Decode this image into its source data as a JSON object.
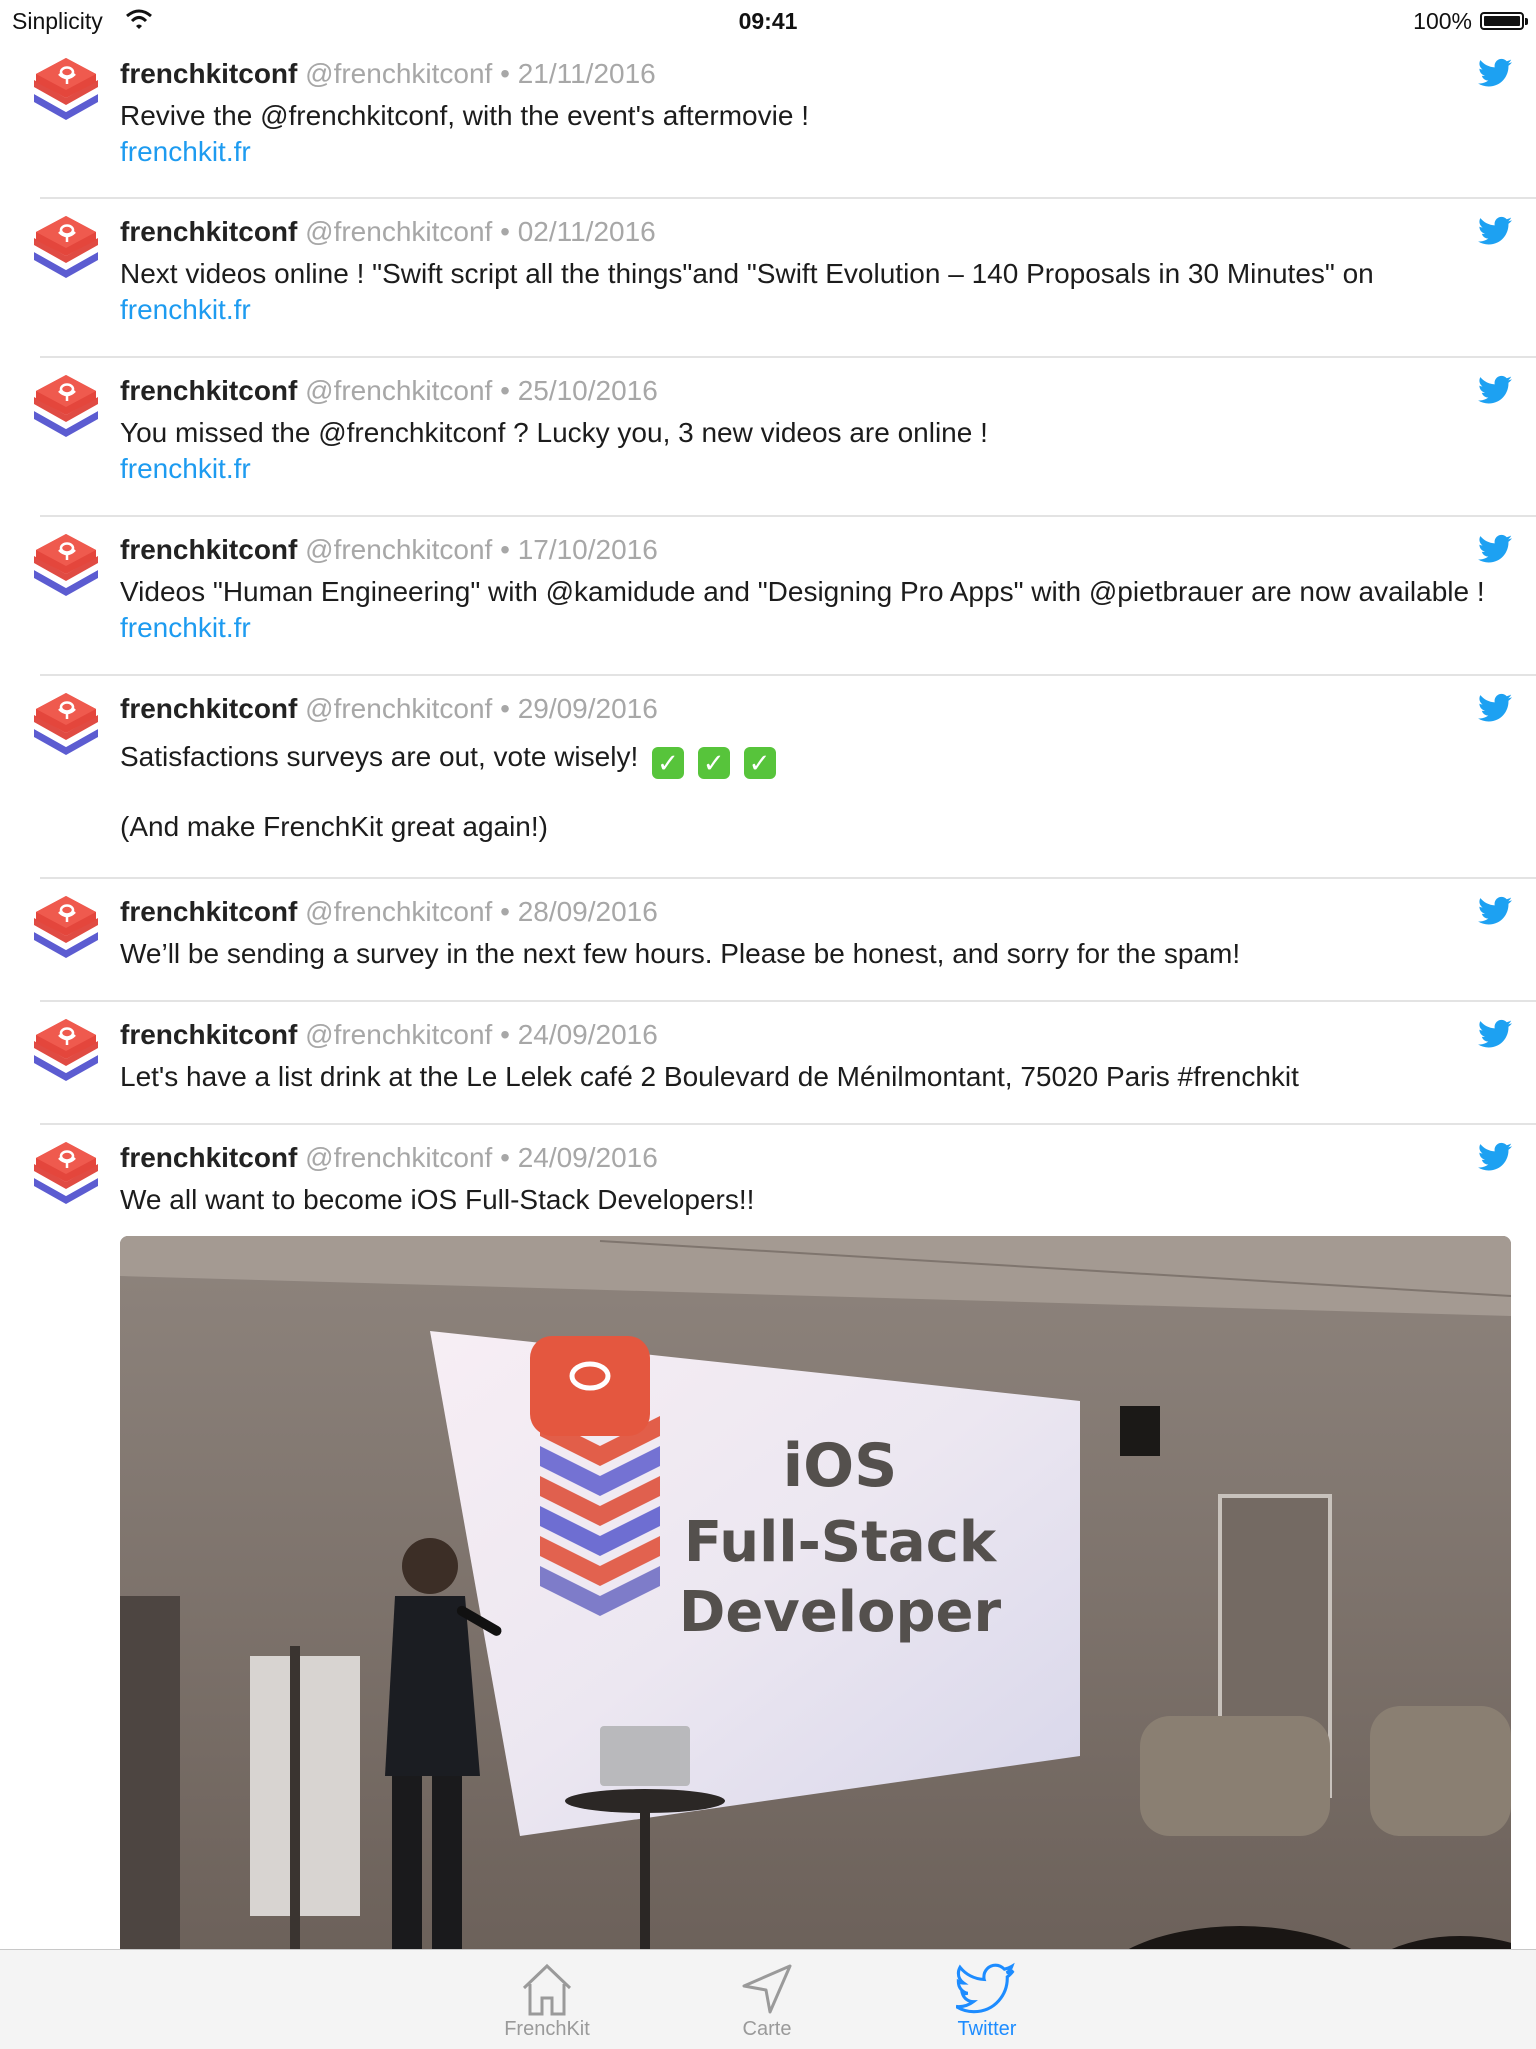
{
  "status_bar": {
    "carrier": "Sinplicity",
    "time": "09:41",
    "battery": "100%"
  },
  "tweets": [
    {
      "name": "frenchkitconf",
      "handle": "@frenchkitconf",
      "dot": "•",
      "date": "21/11/2016",
      "text": "Revive the @frenchkitconf, with the event's aftermovie !",
      "link": "frenchkit.fr"
    },
    {
      "name": "frenchkitconf",
      "handle": "@frenchkitconf",
      "dot": "•",
      "date": "02/11/2016",
      "text": "Next videos online ! \"Swift script all the things\"and \"Swift Evolution – 140 Proposals in 30 Minutes\" on",
      "link": "frenchkit.fr"
    },
    {
      "name": "frenchkitconf",
      "handle": "@frenchkitconf",
      "dot": "•",
      "date": "25/10/2016",
      "text": "You missed the @frenchkitconf ? Lucky you, 3 new videos are online !",
      "link": "frenchkit.fr"
    },
    {
      "name": "frenchkitconf",
      "handle": "@frenchkitconf",
      "dot": "•",
      "date": "17/10/2016",
      "text": "Videos \"Human Engineering\" with @kamidude and \"Designing Pro Apps\" with @pietbrauer are now available !",
      "link": "frenchkit.fr"
    },
    {
      "name": "frenchkitconf",
      "handle": "@frenchkitconf",
      "dot": "•",
      "date": "29/09/2016",
      "text": "Satisfactions surveys are out, vote wisely!",
      "emoji": [
        "✓",
        "✓",
        "✓"
      ],
      "text2": "(And make FrenchKit great again!)"
    },
    {
      "name": "frenchkitconf",
      "handle": "@frenchkitconf",
      "dot": "•",
      "date": "28/09/2016",
      "text": "We’ll be sending a survey in the next few hours. Please be honest, and sorry for the spam!"
    },
    {
      "name": "frenchkitconf",
      "handle": "@frenchkitconf",
      "dot": "•",
      "date": "24/09/2016",
      "text": "Let's have a list drink at the Le Lelek café 2 Boulevard de Ménilmontant, 75020 Paris #frenchkit"
    },
    {
      "name": "frenchkitconf",
      "handle": "@frenchkitconf",
      "dot": "•",
      "date": "24/09/2016",
      "text": "We all want to become iOS Full-Stack Developers!!"
    }
  ],
  "photo": {
    "slide_lines": [
      "iOS",
      "Full-Stack",
      "Developer"
    ]
  },
  "tab_bar": {
    "items": [
      {
        "label": "FrenchKit",
        "icon": "house-icon",
        "active": false
      },
      {
        "label": "Carte",
        "icon": "location-arrow-icon",
        "active": false
      },
      {
        "label": "Twitter",
        "icon": "twitter-bird-icon",
        "active": true
      }
    ]
  },
  "colors": {
    "link": "#1d9bf0",
    "tab_active": "#1d8cff",
    "tab_inactive": "#9a9a9a",
    "meta_gray": "#a7a7a7"
  }
}
